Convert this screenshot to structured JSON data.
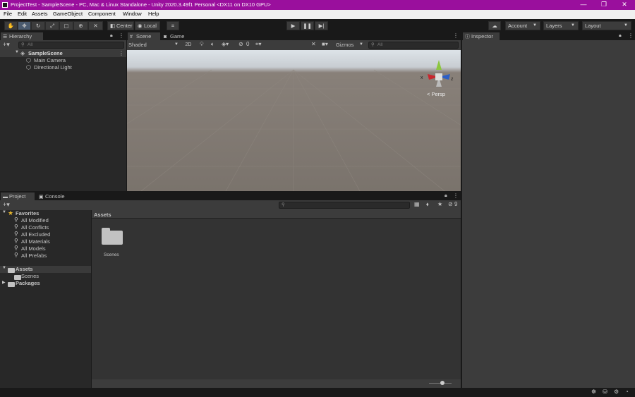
{
  "window": {
    "title": "ProjectTest - SampleScene - PC, Mac & Linux Standalone - Unity 2020.3.49f1 Personal <DX11 on DX10 GPU>",
    "minimize": "—",
    "maximize": "❐",
    "close": "✕"
  },
  "menu": [
    "File",
    "Edit",
    "Assets",
    "GameObject",
    "Component",
    "Window",
    "Help"
  ],
  "toolbar": {
    "tools": [
      "hand-tool",
      "move-tool",
      "rotate-tool",
      "scale-tool",
      "rect-tool",
      "transform-tool",
      "custom-tool"
    ],
    "pivot_center": "Center",
    "pivot_local": "Local",
    "account": "Account",
    "layers": "Layers",
    "layout": "Layout"
  },
  "hierarchy": {
    "tab": "Hierarchy",
    "search_placeholder": "All",
    "scene": "SampleScene",
    "items": [
      "Main Camera",
      "Directional Light"
    ]
  },
  "scene": {
    "tab_scene": "Scene",
    "tab_game": "Game",
    "shading": "Shaded",
    "mode_2d": "2D",
    "hidden_count": "0",
    "gizmos": "Gizmos",
    "search_placeholder": "All",
    "persp": "Persp",
    "axis_x": "x",
    "axis_z": "z"
  },
  "inspector": {
    "tab": "Inspector"
  },
  "project": {
    "tab_project": "Project",
    "tab_console": "Console",
    "hidden_count": "9",
    "favorites_label": "Favorites",
    "favorites": [
      "All Modified",
      "All Conflicts",
      "All Excluded",
      "All Materials",
      "All Models",
      "All Prefabs"
    ],
    "assets_label": "Assets",
    "assets_children": [
      "Scenes"
    ],
    "packages_label": "Packages",
    "breadcrumb": "Assets",
    "grid_items": [
      "Scenes"
    ]
  },
  "colors": {
    "titlebar": "#9a0f9d",
    "selection": "#3e5f96",
    "panel": "#282828"
  }
}
